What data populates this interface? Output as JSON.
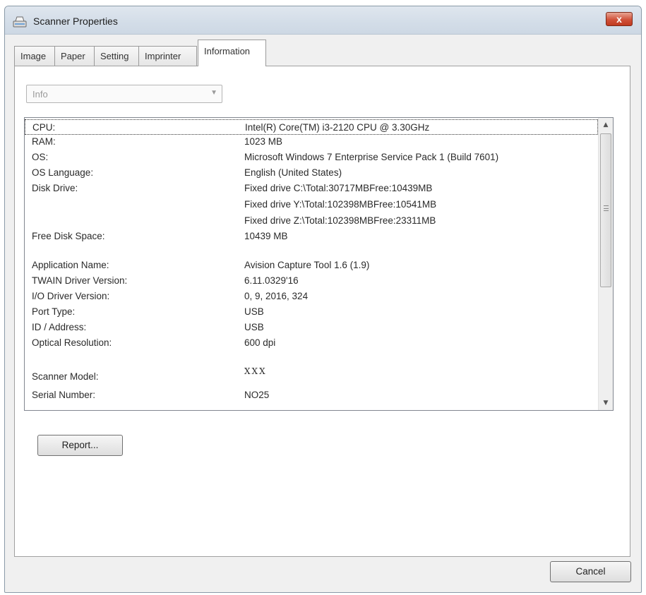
{
  "window": {
    "title": "Scanner Properties",
    "close_label": "x"
  },
  "tabs": [
    {
      "label": "Image",
      "active": false
    },
    {
      "label": "Paper",
      "active": false
    },
    {
      "label": "Setting",
      "active": false
    },
    {
      "label": "Imprinter",
      "active": false
    },
    {
      "label": "Information",
      "active": true
    }
  ],
  "info_combo": {
    "value": "Info"
  },
  "info_rows": [
    {
      "key": "CPU:",
      "value": "Intel(R) Core(TM) i3-2120 CPU @ 3.30GHz"
    },
    {
      "key": "RAM:",
      "value": "1023 MB"
    },
    {
      "key": "OS:",
      "value": "Microsoft Windows 7 Enterprise Service Pack 1 (Build 7601)"
    },
    {
      "key": "OS Language:",
      "value": "English (United States)"
    },
    {
      "key": "Disk Drive:",
      "value": "Fixed drive C:\\Total:30717MBFree:10439MB"
    },
    {
      "key": "",
      "value": "Fixed drive Y:\\Total:102398MBFree:10541MB"
    },
    {
      "key": "",
      "value": "Fixed drive Z:\\Total:102398MBFree:23311MB"
    },
    {
      "key": "Free Disk Space:",
      "value": "10439 MB"
    },
    {
      "key": "Application Name:",
      "value": "Avision Capture Tool 1.6 (1.9)"
    },
    {
      "key": "TWAIN Driver Version:",
      "value": "6.11.0329'16"
    },
    {
      "key": "I/O Driver Version:",
      "value": "0, 9, 2016, 324"
    },
    {
      "key": "Port Type:",
      "value": "USB"
    },
    {
      "key": "ID / Address:",
      "value": "USB"
    },
    {
      "key": "Optical Resolution:",
      "value": "600 dpi"
    },
    {
      "key": "Scanner Model:",
      "value": "XXX"
    },
    {
      "key": "Serial Number:",
      "value": "NO25"
    }
  ],
  "buttons": {
    "report_label": "Report...",
    "cancel_label": "Cancel"
  },
  "colors": {
    "close_button": "#d0523a",
    "panel_background": "#ffffff",
    "window_background": "#f0f0f0"
  }
}
